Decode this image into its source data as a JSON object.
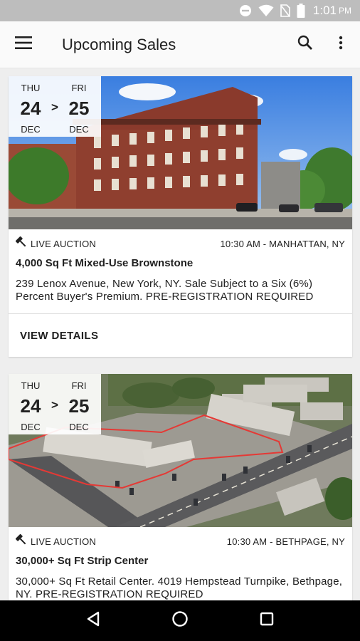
{
  "status_bar": {
    "time": "1:01",
    "icons": [
      "dnd-icon",
      "wifi-icon",
      "no-sim-icon",
      "battery-icon"
    ]
  },
  "app_bar": {
    "title": "Upcoming Sales",
    "icons": [
      "menu-icon",
      "search-icon",
      "more-vert-icon"
    ]
  },
  "listings": [
    {
      "start_day": "THU",
      "start_date": "24",
      "start_month": "DEC",
      "separator": ">",
      "end_day": "FRI",
      "end_date": "25",
      "end_month": "DEC",
      "sale_type": "LIVE AUCTION",
      "time_location": "10:30 AM - MANHATTAN, NY",
      "title": "4,000 Sq Ft Mixed-Use Brownstone",
      "description": "239 Lenox Avenue, New York, NY. Sale Subject to a Six (6%) Percent Buyer's Premium. PRE-REGISTRATION REQUIRED",
      "action_label": "VIEW DETAILS"
    },
    {
      "start_day": "THU",
      "start_date": "24",
      "start_month": "DEC",
      "separator": ">",
      "end_day": "FRI",
      "end_date": "25",
      "end_month": "DEC",
      "sale_type": "LIVE AUCTION",
      "time_location": "10:30 AM - BETHPAGE, NY",
      "title": "30,000+ Sq Ft Strip Center",
      "description": "30,000+ Sq Ft Retail Center. 4019 Hempstead Turnpike, Bethpage, NY. PRE-REGISTRATION REQUIRED"
    }
  ],
  "nav_bar": {
    "icons": [
      "back-icon",
      "home-icon",
      "recents-icon"
    ]
  },
  "colors": {
    "status_bar": "#bdbdbd",
    "app_bar": "#fafafa",
    "background": "#eeeeee",
    "nav_bar": "#000000",
    "lot_outline": "#e53935"
  }
}
